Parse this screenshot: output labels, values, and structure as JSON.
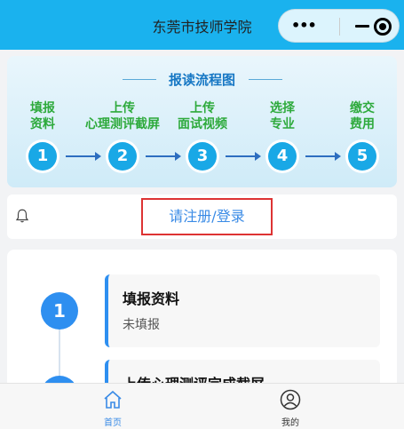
{
  "header": {
    "title": "东莞市技师学院"
  },
  "capsule": {
    "more_icon": "more-icon",
    "minimize_icon": "minimize-icon",
    "close_icon": "target-icon"
  },
  "flow": {
    "title": "报读流程图",
    "steps": [
      {
        "num": "1",
        "label": "填报\n资料"
      },
      {
        "num": "2",
        "label": "上传\n心理测评截屏"
      },
      {
        "num": "3",
        "label": "上传\n面试视频"
      },
      {
        "num": "4",
        "label": "选择\n专业"
      },
      {
        "num": "5",
        "label": "缴交\n费用"
      }
    ]
  },
  "notice": {
    "icon": "bell-icon",
    "login_text": "请注册/登录"
  },
  "tasks": [
    {
      "num": "1",
      "title": "填报资料",
      "status": "未填报"
    },
    {
      "num": "2",
      "title": "上传心理测评完成截屏",
      "status": ""
    }
  ],
  "tabbar": {
    "items": [
      {
        "label": "首页",
        "icon": "home-icon",
        "active": true
      },
      {
        "label": "我的",
        "icon": "user-icon",
        "active": false
      }
    ]
  },
  "colors": {
    "header_bg": "#1ab2ee",
    "accent": "#2e8ff0",
    "step_label": "#2eaa3c",
    "highlight_border": "#d33"
  }
}
